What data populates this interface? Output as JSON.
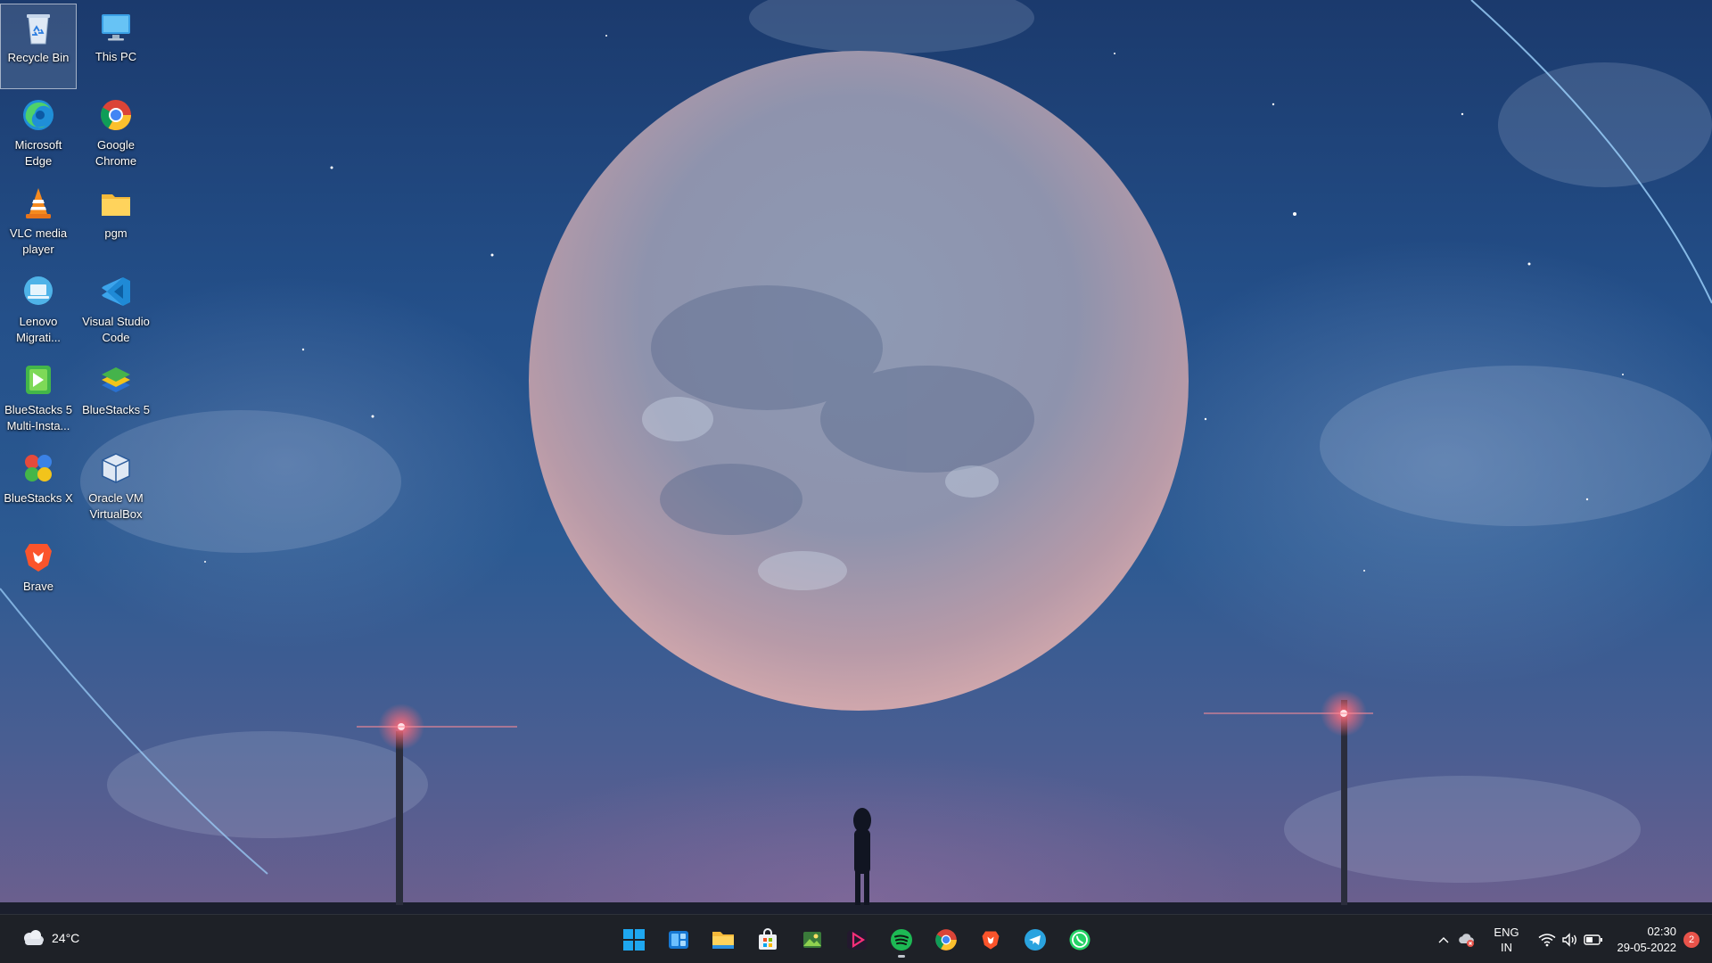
{
  "desktop": {
    "icons": [
      {
        "label": "Recycle Bin",
        "icon": "recycle-bin-icon",
        "selected": true
      },
      {
        "label": "This PC",
        "icon": "monitor-icon"
      },
      {
        "label": "Microsoft\nEdge",
        "icon": "edge-icon"
      },
      {
        "label": "Google\nChrome",
        "icon": "chrome-icon"
      },
      {
        "label": "VLC media\nplayer",
        "icon": "vlc-cone-icon"
      },
      {
        "label": "pgm",
        "icon": "folder-icon"
      },
      {
        "label": "Lenovo\nMigrati...",
        "icon": "lenovo-migration-icon"
      },
      {
        "label": "Visual Studio\nCode",
        "icon": "vscode-icon"
      },
      {
        "label": "BlueStacks 5\nMulti-Insta...",
        "icon": "bluestacks-multi-icon"
      },
      {
        "label": "BlueStacks 5",
        "icon": "bluestacks-icon"
      },
      {
        "label": "BlueStacks X",
        "icon": "bluestacks-x-icon"
      },
      {
        "label": "Oracle VM\nVirtualBox",
        "icon": "virtualbox-icon"
      },
      {
        "label": "Brave",
        "icon": "brave-icon"
      }
    ]
  },
  "taskbar": {
    "weather": {
      "temp": "24°C",
      "icon": "cloudy-night-icon"
    },
    "apps": [
      {
        "name": "start",
        "icon": "windows-start-icon"
      },
      {
        "name": "widgets",
        "icon": "widgets-icon"
      },
      {
        "name": "file-explorer",
        "icon": "folder-icon"
      },
      {
        "name": "microsoft-store",
        "icon": "store-icon"
      },
      {
        "name": "photos",
        "icon": "photos-icon"
      },
      {
        "name": "media-player",
        "icon": "media-player-icon"
      },
      {
        "name": "spotify",
        "icon": "spotify-icon",
        "running": true
      },
      {
        "name": "chrome",
        "icon": "chrome-icon"
      },
      {
        "name": "brave",
        "icon": "brave-icon"
      },
      {
        "name": "telegram",
        "icon": "telegram-icon"
      },
      {
        "name": "whatsapp",
        "icon": "whatsapp-icon"
      }
    ],
    "tray": {
      "lang_line1": "ENG",
      "lang_line2": "IN",
      "time": "02:30",
      "date": "29-05-2022",
      "notifications": "2"
    }
  },
  "colors": {
    "taskbar": "#1e2127",
    "accent": "#0a84ff",
    "spotify": "#1db954",
    "notification": "#e8534a"
  }
}
